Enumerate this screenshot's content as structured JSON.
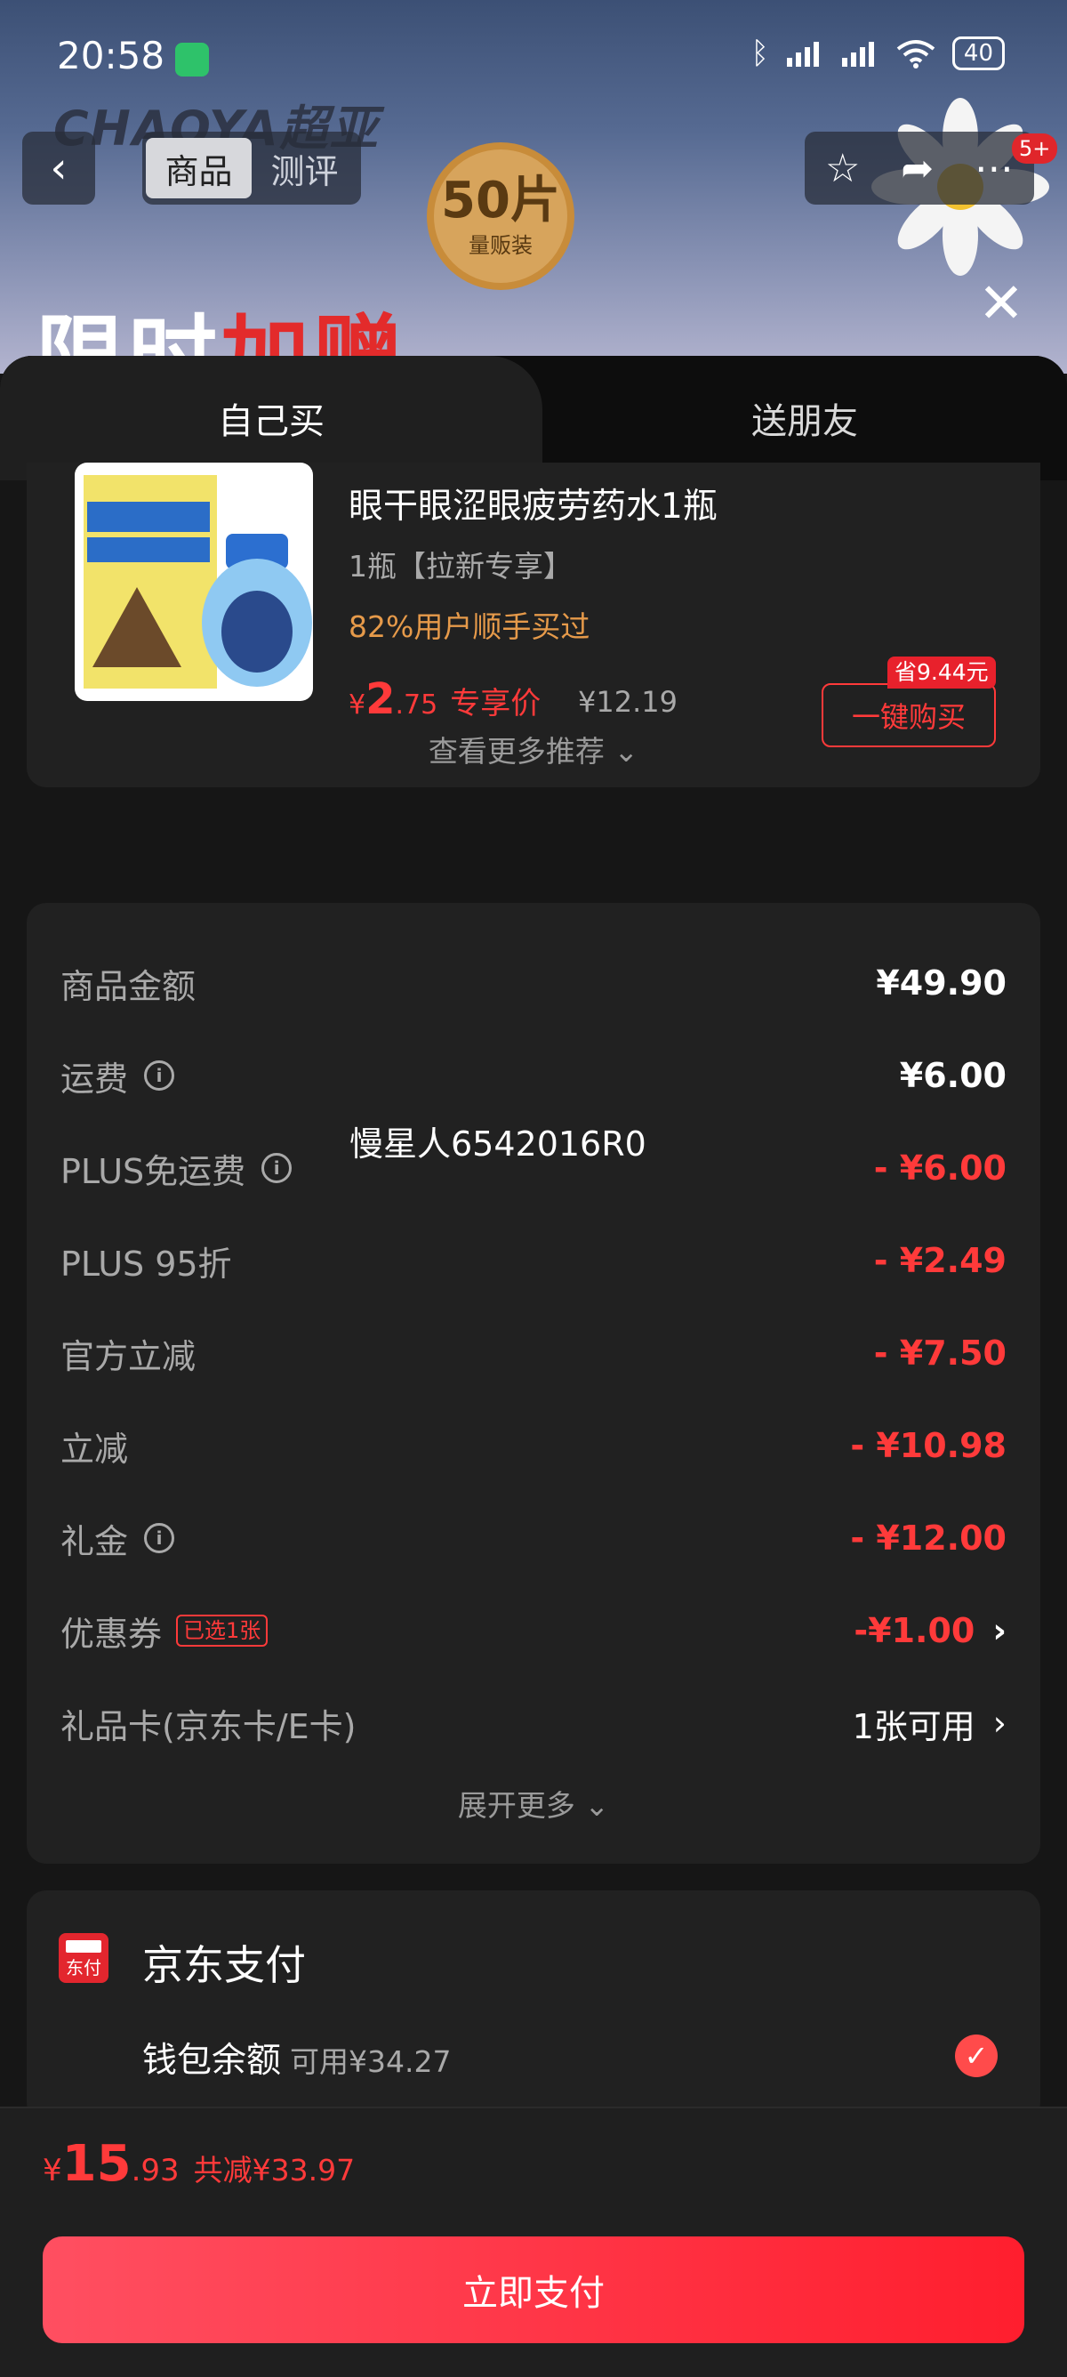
{
  "status_bar": {
    "time": "20:58",
    "battery": "40"
  },
  "nav": {
    "tabs": [
      "商品",
      "测评"
    ],
    "badge": "5+"
  },
  "banner": {
    "brand": "CHAOYA超亚",
    "badge_num": "50片",
    "badge_text": "量贩装",
    "promo_a": "限时",
    "promo_b": "加赠"
  },
  "sheet_tabs": {
    "self": "自己买",
    "gift": "送朋友"
  },
  "recommend": {
    "title": "眼干眼涩眼疲劳药水1瓶",
    "spec": "1瓶【拉新专享】",
    "social": "82%用户顺手买过",
    "currency": "¥",
    "price_int": "2",
    "price_dec": ".75",
    "price_label": "专享价",
    "orig_price": "¥12.19",
    "save_tag": "省9.44元",
    "buy_label": "一键购买",
    "more": "查看更多推荐 ⌄"
  },
  "summary": {
    "rows": [
      {
        "label": "商品金额",
        "value": "¥49.90"
      },
      {
        "label": "运费",
        "value": "¥6.00"
      },
      {
        "label": "PLUS免运费",
        "value": "- ¥6.00"
      },
      {
        "label": "PLUS 95折",
        "value": "- ¥2.49"
      },
      {
        "label": "官方立减",
        "value": "- ¥7.50"
      },
      {
        "label": "立减",
        "value": "- ¥10.98"
      },
      {
        "label": "礼金",
        "value": "- ¥12.00"
      },
      {
        "label": "优惠券",
        "value": "-¥1.00",
        "tag": "已选1张"
      },
      {
        "label": "礼品卡(京东卡/E卡)",
        "value": "1张可用"
      }
    ],
    "overlay_name": "慢星人6542016R0",
    "expand": "展开更多 ⌄"
  },
  "payment": {
    "icon_text": "东付",
    "title": "京东支付",
    "wallet_label": "钱包余额",
    "wallet_avail": "可用¥34.27"
  },
  "bottom": {
    "currency": "¥",
    "total_int": "15",
    "total_dec": ".93",
    "reduced": "共减¥33.97",
    "pay_label": "立即支付"
  },
  "colors": {
    "accent": "#ff3a3a",
    "bg": "#161616",
    "card": "#212121"
  }
}
